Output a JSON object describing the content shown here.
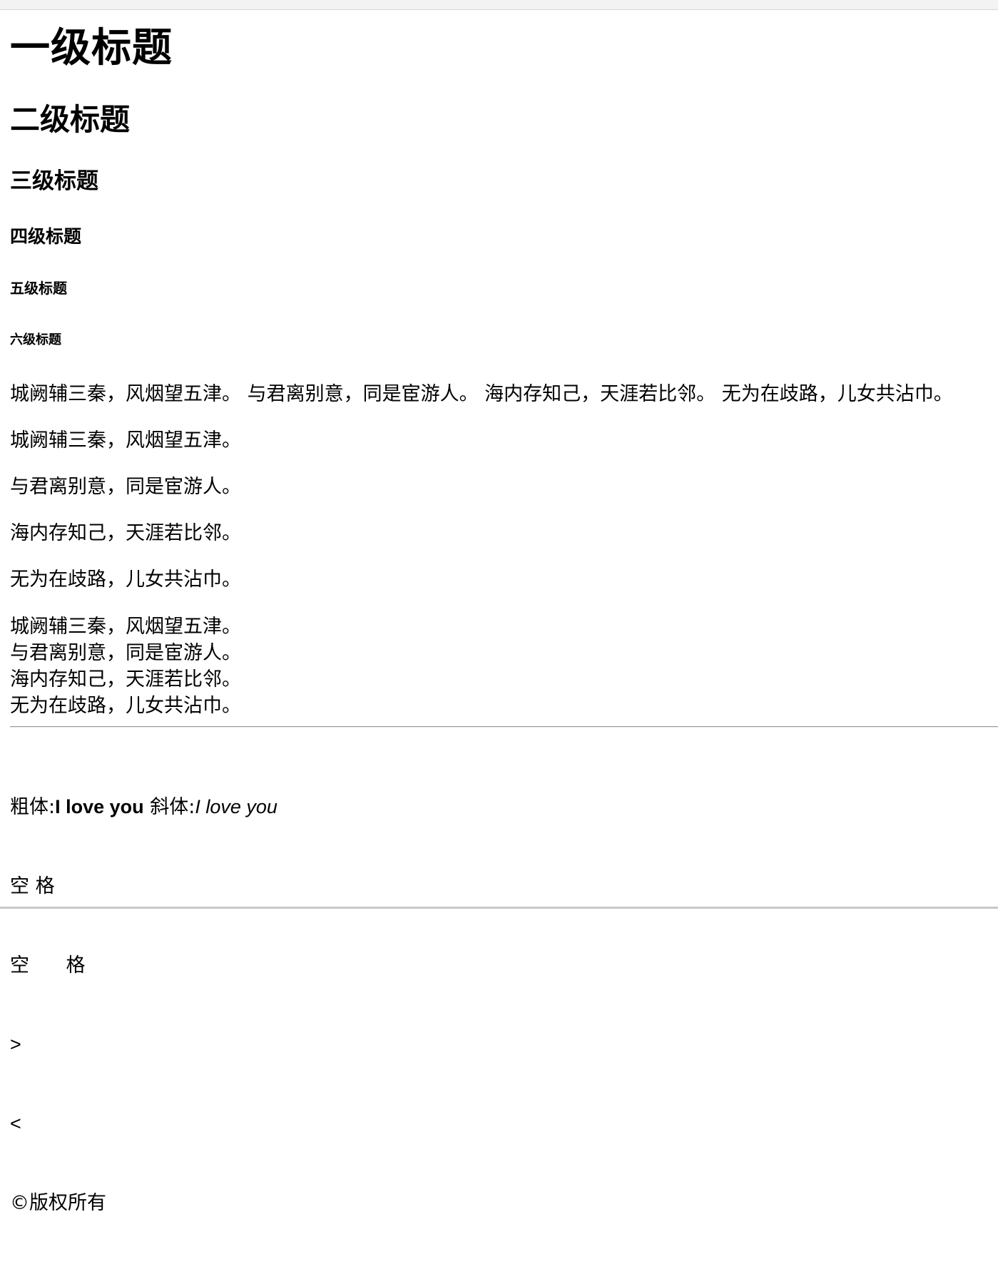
{
  "headings": {
    "h1": "一级标题",
    "h2": "二级标题",
    "h3": "三级标题",
    "h4": "四级标题",
    "h5": "五级标题",
    "h6": "六级标题"
  },
  "paragraphs": {
    "long": "城阙辅三秦，风烟望五津。 与君离别意，同是宦游人。 海内存知己，天涯若比邻。 无为在歧路，儿女共沾巾。",
    "lines": [
      "城阙辅三秦，风烟望五津。",
      "与君离别意，同是宦游人。",
      "海内存知己，天涯若比邻。",
      "无为在歧路，儿女共沾巾。"
    ]
  },
  "poem_block": [
    "城阙辅三秦，风烟望五津。",
    "与君离别意，同是宦游人。",
    "海内存知己，天涯若比邻。",
    "无为在歧路，儿女共沾巾。"
  ],
  "tail": {
    "bold_label": "粗体:",
    "bold_text": "I love you",
    "italic_label": " 斜体:",
    "italic_text": "I love you",
    "space1": "空 格",
    "space2": "空      格",
    "gt": ">",
    "lt": "<",
    "copyright": "©版权所有"
  }
}
